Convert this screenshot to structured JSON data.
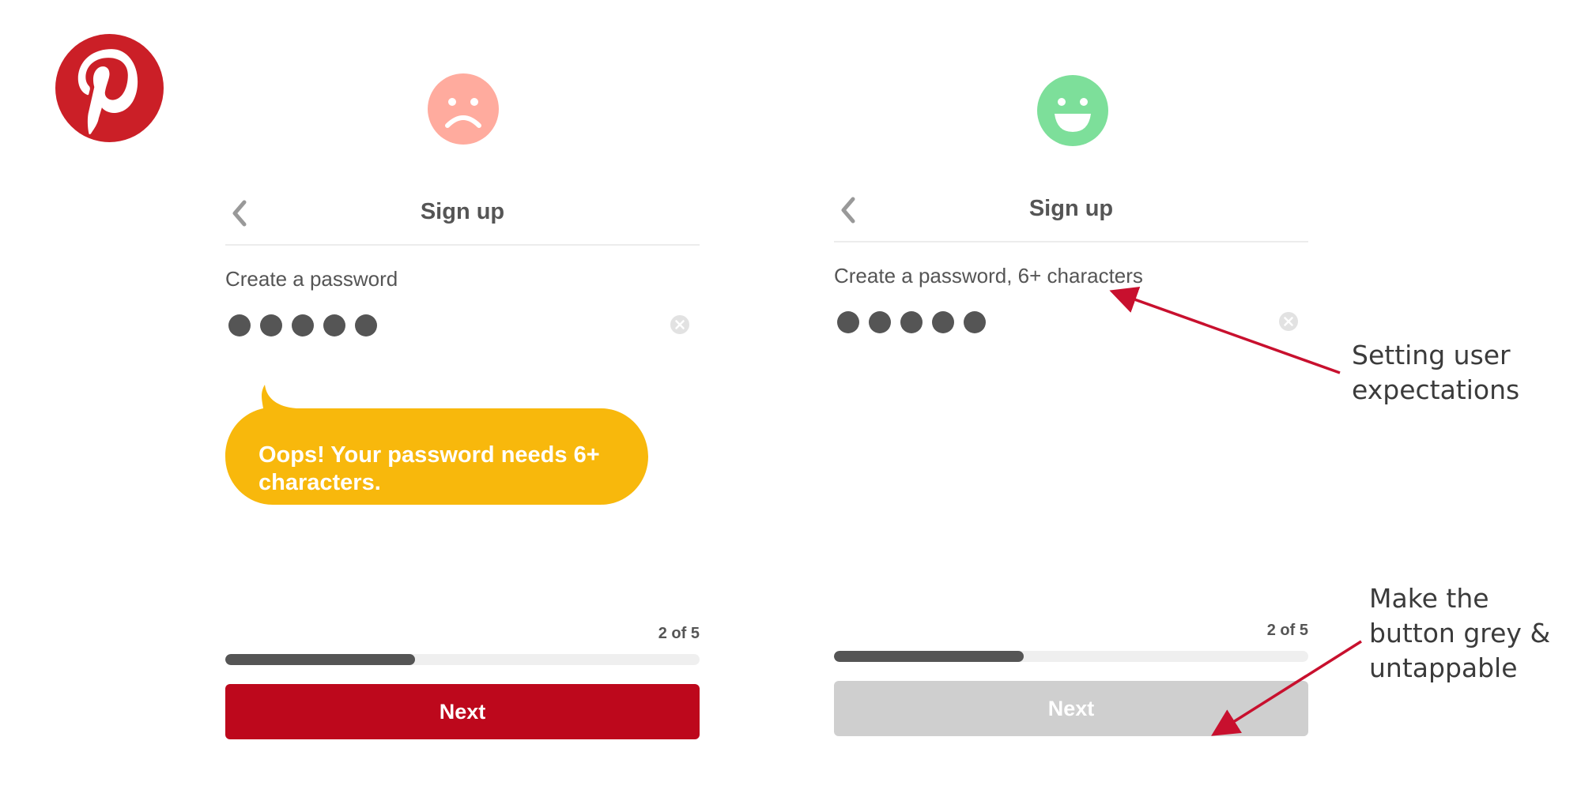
{
  "brand": {
    "name": "Pinterest",
    "color": "#cb1f27"
  },
  "faces": {
    "sad": {
      "icon": "sad-face-icon",
      "color": "#ffab9e"
    },
    "happy": {
      "icon": "happy-face-icon",
      "color": "#7ddf9a"
    }
  },
  "screens": {
    "before": {
      "title": "Sign up",
      "password_label": "Create a password",
      "password_dots": 5,
      "error_message": "Oops! Your password needs 6+ characters.",
      "error_color": "#f8b80c",
      "step_text": "2 of 5",
      "progress_fraction": 0.4,
      "next_label": "Next",
      "next_enabled": true,
      "next_color": "#bd081c"
    },
    "after": {
      "title": "Sign up",
      "password_label": "Create a password, 6+ characters",
      "password_dots": 5,
      "step_text": "2 of 5",
      "progress_fraction": 0.4,
      "next_label": "Next",
      "next_enabled": false,
      "next_color": "#cfcfcf"
    }
  },
  "annotations": {
    "expectations": {
      "line1": "Setting user",
      "line2": "expectations"
    },
    "button": {
      "line1": "Make the",
      "line2": "button grey &",
      "line3": "untappable"
    },
    "arrow_color": "#c8102e"
  }
}
